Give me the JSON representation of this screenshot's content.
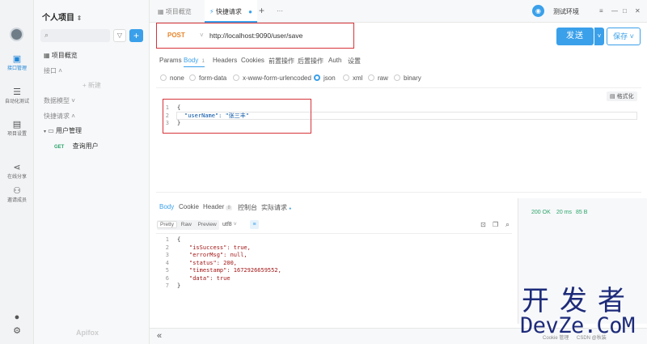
{
  "rail": {
    "items": [
      {
        "label": "接口管理"
      },
      {
        "label": "自动化测试"
      },
      {
        "label": "项目设置"
      },
      {
        "label": "在线分享"
      },
      {
        "label": "邀请成员"
      }
    ]
  },
  "sidebar": {
    "project_title": "个人项目",
    "search_placeholder": "",
    "overview": "项目概览",
    "api_section": "接口",
    "new_button": "+ 新建",
    "data_model": "数据模型",
    "quick_request": "快捷请求",
    "folder": "用户管理",
    "request_method": "GET",
    "request_name": "查询用户",
    "brand": "Apifox"
  },
  "tabs": {
    "items": [
      "项目概览",
      "快捷请求"
    ],
    "env": "测试环境"
  },
  "request": {
    "method": "POST",
    "url": "http://localhost:9090/user/save",
    "send": "发送",
    "save": "保存"
  },
  "param_tabs": [
    "Params",
    "Body",
    "Headers",
    "Cookies",
    "前置操作",
    "后置操作",
    "Auth",
    "设置"
  ],
  "body_count": "1",
  "body_types": [
    "none",
    "form-data",
    "x-www-form-urlencoded",
    "json",
    "xml",
    "raw",
    "binary"
  ],
  "format_button": "格式化",
  "request_body": {
    "lines": [
      "{",
      "\"userName\": \"张三丰\"",
      "}"
    ]
  },
  "response": {
    "tabs": [
      "Body",
      "Cookie",
      "Header",
      "控制台",
      "实际请求"
    ],
    "header_count": "8",
    "view_modes": [
      "Pretty",
      "Raw",
      "Preview"
    ],
    "encoding": "utf8",
    "lines": [
      "{",
      "\"isSuccess\": true,",
      "\"errorMsg\": null,",
      "\"status\": 200,",
      "\"timestamp\": 1672926659552,",
      "\"data\": true",
      "}"
    ],
    "status_code": "200 OK",
    "time": "20 ms",
    "size": "85 B"
  },
  "bottom": {
    "cookie": "Cookie 管理",
    "credit": "CSDN @秋装"
  },
  "watermark": {
    "cn": "开发者",
    "en": "DevZe.CoM"
  },
  "colors": {
    "accent": "#3aa0ea",
    "method_post": "#e8842a",
    "highlight_box": "#d6343a"
  }
}
